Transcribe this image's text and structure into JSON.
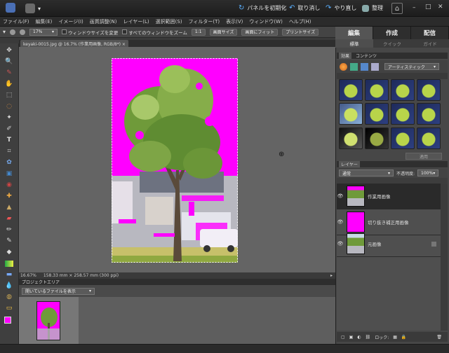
{
  "titlebar": {
    "reset_panels": "パネルを初期化",
    "undo": "取り消し",
    "redo": "やり直し",
    "organize": "整理"
  },
  "menu": [
    "ファイル(F)",
    "編集(E)",
    "イメージ(I)",
    "画質調整(N)",
    "レイヤー(L)",
    "選択範囲(S)",
    "フィルター(T)",
    "表示(V)",
    "ウィンドウ(W)",
    "ヘルプ(H)"
  ],
  "options": {
    "zoom_value": "17%",
    "resize_windows": "ウィンドウサイズを変更",
    "zoom_all": "すべてのウィンドウをズーム",
    "one_to_one": "1:1",
    "fit_screen": "画面サイズ",
    "fill_screen": "画面にフィット",
    "print_size": "プリントサイズ"
  },
  "document": {
    "tab_title": "keyaki-0015.jpg @ 16.7% (作業用画像, RGB/8*) ×"
  },
  "status": {
    "zoom": "16.67%",
    "dimensions": "158.33 mm × 258.57 mm (300 ppi)"
  },
  "project_bin": {
    "header": "プロジェクトエリア",
    "dropdown": "開いているファイルを表示"
  },
  "right_panel": {
    "tabs": [
      "編集",
      "作成",
      "配信"
    ],
    "subtabs": [
      "標準",
      "クイック",
      "ガイド"
    ],
    "effects_tabs": [
      "効果",
      "コンテンツ"
    ],
    "filter_dropdown": "アーティスティック",
    "apply": "適用"
  },
  "layers": {
    "header": "レイヤー",
    "blend_mode": "通常",
    "opacity_label": "不透明度:",
    "opacity_value": "100%",
    "items": [
      {
        "name": "作業用画像"
      },
      {
        "name": "切り抜き補正用画像"
      },
      {
        "name": "元画像"
      }
    ],
    "lock_label": "ロック:"
  },
  "colors": {
    "magenta": "#ff00ff",
    "panel_dark": "#2e2e2e",
    "canvas_bg": "#646464"
  }
}
